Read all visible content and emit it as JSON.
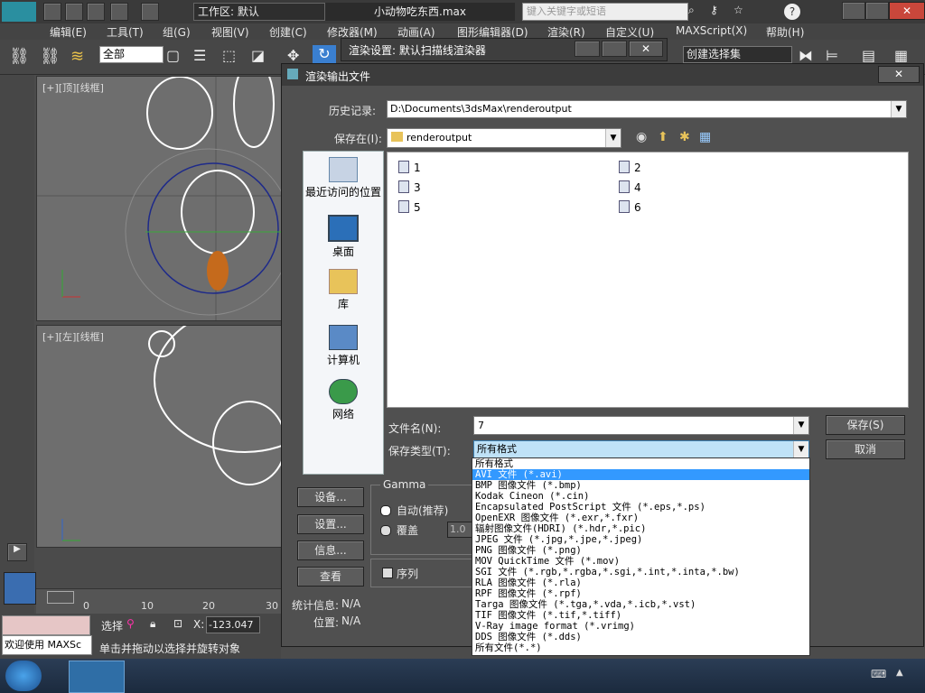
{
  "app": {
    "file_title": "小动物吃东西.max",
    "workspace_label": "工作区: 默认",
    "search_placeholder": "键入关键字或短语"
  },
  "menu": [
    "编辑(E)",
    "工具(T)",
    "组(G)",
    "视图(V)",
    "创建(C)",
    "修改器(M)",
    "动画(A)",
    "图形编辑器(D)",
    "渲染(R)",
    "自定义(U)",
    "MAXScript(X)",
    "帮助(H)"
  ],
  "toolbar": {
    "filter_value": "全部",
    "selection_set": "创建选择集"
  },
  "viewports": {
    "top_label": "[+][顶][线框]",
    "left_label": "[+][左][线框]"
  },
  "render_setup": {
    "title": "渲染设置: 默认扫描线渲染器"
  },
  "dialog": {
    "title": "渲染输出文件",
    "history_label": "历史记录:",
    "history_value": "D:\\Documents\\3dsMax\\renderoutput",
    "savein_label": "保存在(I):",
    "savein_value": "renderoutput",
    "places": [
      "最近访问的位置",
      "桌面",
      "库",
      "计算机",
      "网络"
    ],
    "files": [
      "1",
      "2",
      "3",
      "4",
      "5",
      "6"
    ],
    "filename_label": "文件名(N):",
    "filename_value": "7",
    "filetype_label": "保存类型(T):",
    "filetype_value": "所有格式",
    "save_button": "保存(S)",
    "cancel_button": "取消",
    "setup_button": "设备...",
    "settings_button": "设置...",
    "info_button": "信息...",
    "view_button": "查看",
    "gamma_label": "Gamma",
    "gamma_auto": "自动(推荐)",
    "gamma_override": "覆盖",
    "gamma_value": "1.0",
    "sequence_label": "序列",
    "stats_label": "统计信息:",
    "stats_value": "N/A",
    "location_label": "位置:",
    "location_value": "N/A"
  },
  "filetypes": [
    "所有格式",
    "AVI 文件 (*.avi)",
    "BMP 图像文件 (*.bmp)",
    "Kodak Cineon (*.cin)",
    "Encapsulated PostScript 文件 (*.eps,*.ps)",
    "OpenEXR 图像文件 (*.exr,*.fxr)",
    "辐射图像文件(HDRI) (*.hdr,*.pic)",
    "JPEG 文件 (*.jpg,*.jpe,*.jpeg)",
    "PNG 图像文件 (*.png)",
    "MOV QuickTime 文件 (*.mov)",
    "SGI 文件 (*.rgb,*.rgba,*.sgi,*.int,*.inta,*.bw)",
    "RLA 图像文件 (*.rla)",
    "RPF 图像文件 (*.rpf)",
    "Targa 图像文件 (*.tga,*.vda,*.icb,*.vst)",
    "TIF 图像文件 (*.tif,*.tiff)",
    "V-Ray image format (*.vrimg)",
    "DDS 图像文件 (*.dds)",
    "所有文件(*.*)"
  ],
  "status": {
    "welcome": "欢迎使用 MAXSc",
    "select_label": "选择",
    "x_label": "X:",
    "x_value": "-123.047",
    "hint": "单击并拖动以选择并旋转对象"
  },
  "timeline": {
    "ticks": [
      "0",
      "10",
      "20",
      "30"
    ]
  }
}
